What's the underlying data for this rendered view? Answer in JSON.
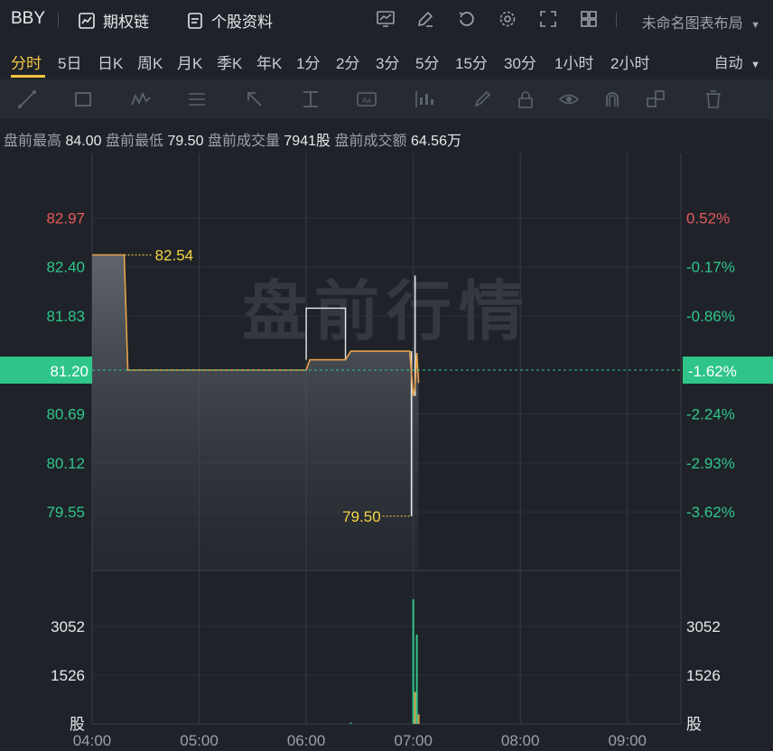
{
  "topbar": {
    "ticker": "BBY",
    "options_chain": "期权链",
    "stock_info": "个股资料",
    "layout_name": "未命名图表布局"
  },
  "periods": [
    "分时",
    "5日",
    "日K",
    "周K",
    "月K",
    "季K",
    "年K",
    "1分",
    "2分",
    "3分",
    "5分",
    "15分",
    "30分",
    "1小时",
    "2小时"
  ],
  "active_period": "分时",
  "auto_label": "自动",
  "toolbar_icons": [
    "line-tool-icon",
    "rect-tool-icon",
    "pattern-tool-icon",
    "fib-tool-icon",
    "arrow-tool-icon",
    "measure-tool-icon",
    "text-tool-icon",
    "indicator-tool-icon",
    "brush-icon",
    "lock-icon",
    "eye-icon",
    "magnet-icon",
    "layers-icon",
    "trash-icon"
  ],
  "stats": {
    "high_label": "盘前最高",
    "high_value": "84.00",
    "low_label": "盘前最低",
    "low_value": "79.50",
    "vol_label": "盘前成交量",
    "vol_value": "7941股",
    "amt_label": "盘前成交额",
    "amt_value": "64.56万"
  },
  "watermark": "盘前行情",
  "chart_data": {
    "type": "line",
    "prev_close": 81.2,
    "prev_close_pct": "-1.62%",
    "y_ticks": [
      {
        "price": "82.97",
        "pct": "0.52%",
        "color": "#e65a5a"
      },
      {
        "price": "82.40",
        "pct": "-0.17%",
        "color": "#2fc58a"
      },
      {
        "price": "81.83",
        "pct": "-0.86%",
        "color": "#2fc58a"
      },
      {
        "price": "80.69",
        "pct": "-2.24%",
        "color": "#2fc58a"
      },
      {
        "price": "80.12",
        "pct": "-2.93%",
        "color": "#2fc58a"
      },
      {
        "price": "79.55",
        "pct": "-3.62%",
        "color": "#2fc58a"
      }
    ],
    "x_ticks": [
      "04:00",
      "05:00",
      "06:00",
      "07:00",
      "08:00",
      "09:00"
    ],
    "price_ylim": [
      79.1,
      83.3
    ],
    "high_label": "82.54",
    "low_label": "79.50",
    "price_line": [
      {
        "t": "04:00",
        "p": 82.54
      },
      {
        "t": "04:18",
        "p": 82.54
      },
      {
        "t": "04:20",
        "p": 81.2
      },
      {
        "t": "06:00",
        "p": 81.2
      },
      {
        "t": "06:02",
        "p": 81.32
      },
      {
        "t": "06:22",
        "p": 81.32
      },
      {
        "t": "06:25",
        "p": 81.42
      },
      {
        "t": "06:58",
        "p": 81.42
      },
      {
        "t": "07:00",
        "p": 80.9
      },
      {
        "t": "07:01",
        "p": 81.0
      },
      {
        "t": "07:02",
        "p": 81.4
      },
      {
        "t": "07:03",
        "p": 81.05
      }
    ],
    "price_bars": [
      {
        "t": "06:00",
        "p": 81.92
      },
      {
        "t": "06:22",
        "p": 81.92
      },
      {
        "t": "06:59",
        "p": 79.5
      },
      {
        "t": "07:01",
        "p": 82.3
      }
    ],
    "volume_ticks": [
      "3052",
      "1526"
    ],
    "volume_unit": "股",
    "volume_ylim": [
      0,
      4578
    ],
    "volume": [
      {
        "t": "06:25",
        "v": 40,
        "color": "#2fc58a"
      },
      {
        "t": "07:00",
        "v": 3900,
        "color": "#2fc58a"
      },
      {
        "t": "07:01",
        "v": 1000,
        "color": "#e0a050"
      },
      {
        "t": "07:02",
        "v": 2800,
        "color": "#2fc58a"
      },
      {
        "t": "07:03",
        "v": 300,
        "color": "#e0a050"
      }
    ]
  }
}
